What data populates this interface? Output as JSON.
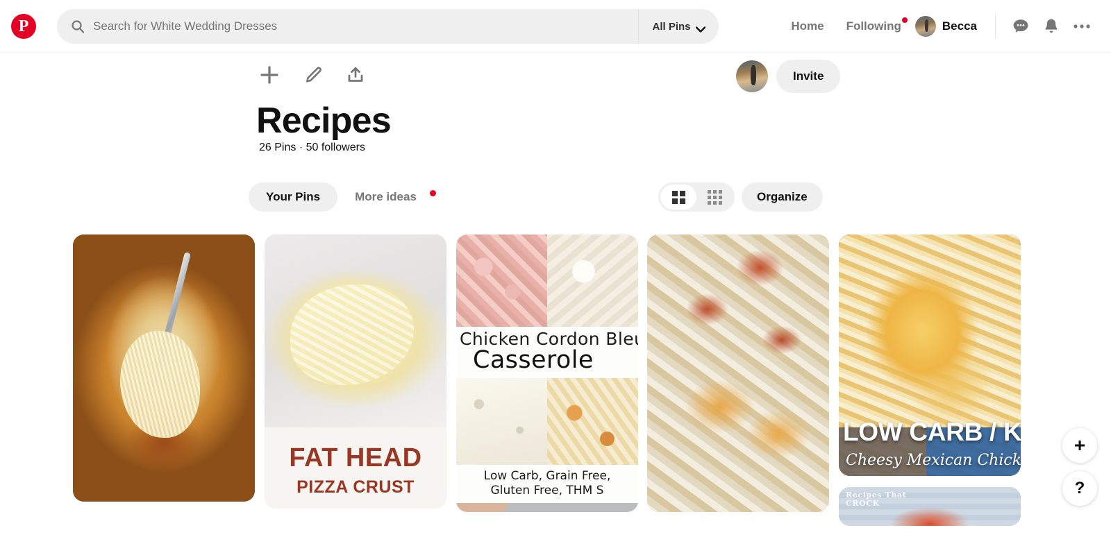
{
  "header": {
    "logo_icon": "pinterest-logo-icon",
    "logo_letter": "P",
    "brand_color": "#e60023",
    "search": {
      "icon": "search-icon",
      "placeholder": "Search for White Wedding Dresses",
      "value": ""
    },
    "scope_filter": {
      "label": "All Pins",
      "icon": "chevron-down-icon"
    },
    "nav": [
      {
        "label": "Home",
        "badge": false
      },
      {
        "label": "Following",
        "badge": true
      }
    ],
    "user": {
      "name": "Becca",
      "avatar": "user-avatar"
    },
    "actions": [
      {
        "name": "messages-icon",
        "label": "Messages"
      },
      {
        "name": "notifications-bell-icon",
        "label": "Notifications"
      },
      {
        "name": "more-options-icon",
        "label": "More options"
      }
    ]
  },
  "board": {
    "title": "Recipes",
    "meta": "26 Pins · 50 followers",
    "pin_count": "26 Pins",
    "follower_count": "50 followers",
    "tools": [
      {
        "name": "add-pin-icon",
        "label": "Add"
      },
      {
        "name": "edit-board-icon",
        "label": "Edit"
      },
      {
        "name": "share-board-icon",
        "label": "Share"
      }
    ],
    "collaborator_avatar": "collaborator-avatar",
    "invite_label": "Invite"
  },
  "tabs": [
    {
      "label": "Your Pins",
      "active": true,
      "badge": false
    },
    {
      "label": "More ideas",
      "active": false,
      "badge": true
    }
  ],
  "view_controls": {
    "grid_large": {
      "name": "grid-large-view-icon",
      "active": true
    },
    "grid_small": {
      "name": "grid-small-view-icon",
      "active": false
    },
    "organize_label": "Organize"
  },
  "pins": [
    {
      "name": "pin-spaghetti-squash-casserole",
      "alt": "Cheesy spaghetti squash casserole with a fork",
      "overlay_text": []
    },
    {
      "name": "pin-fat-head-pizza-crust",
      "alt": "Fat head pizza crust dough",
      "overlay_text": [
        "FAT HEAD",
        "PIZZA CRUST"
      ]
    },
    {
      "name": "pin-chicken-cordon-bleu-casserole",
      "alt": "Chicken cordon bleu casserole collage",
      "overlay_text": [
        "Chicken Cordon Bleu",
        "Casserole",
        "Low Carb, Grain Free,",
        "Gluten Free, THM S"
      ]
    },
    {
      "name": "pin-bacon-cheeseburger-casserole",
      "alt": "Bacon cheeseburger casserole close up",
      "overlay_text": []
    },
    {
      "name": "pin-cheesy-mexican-chicken-skillet",
      "alt": "Cheesy Mexican chicken skillet",
      "overlay_text": [
        "LOW CARB / KETO",
        "Cheesy Mexican Chicken Skillet"
      ]
    },
    {
      "name": "pin-crock-pot-recipe",
      "alt": "Crock pot recipe with red sauce",
      "overlay_text": [
        "Recipes That",
        "CROCK"
      ]
    }
  ],
  "floating_buttons": [
    {
      "name": "create-pin-fab",
      "glyph": "+"
    },
    {
      "name": "help-fab",
      "glyph": "?"
    }
  ]
}
